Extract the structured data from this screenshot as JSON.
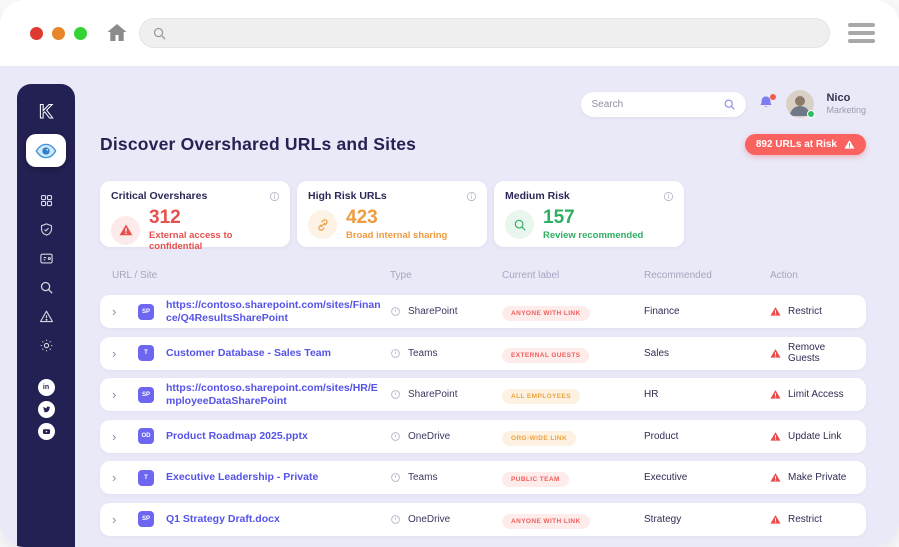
{
  "browser": {
    "traffic_lights": {
      "close": "#df3a32",
      "minimize": "#e8872a",
      "zoom": "#35d435"
    },
    "home_icon": "home-icon",
    "address": {
      "value": "",
      "search_icon": "search-icon"
    },
    "menu_icon": "hamburger-icon"
  },
  "sidebar": {
    "logo": "K",
    "active_item": {
      "icon": "eye"
    },
    "menu": [
      {
        "icon": "grid"
      },
      {
        "icon": "shield-check"
      },
      {
        "icon": "id-card"
      },
      {
        "icon": "search"
      },
      {
        "icon": "warning-outline"
      },
      {
        "icon": "gear"
      }
    ],
    "social": [
      {
        "icon": "linkedin"
      },
      {
        "icon": "twitter"
      },
      {
        "icon": "youtube"
      }
    ]
  },
  "header": {
    "search_placeholder": "Search",
    "notifications_icon": "bell",
    "user": {
      "name": "Nico",
      "role": "Marketing"
    }
  },
  "page": {
    "title": "Discover Overshared URLs and Sites",
    "risk_badge": {
      "label": "892 URLs at Risk",
      "icon": "warning-solid",
      "color": "#f9625f"
    }
  },
  "stats": [
    {
      "title": "Critical Overshares",
      "value": "312",
      "caption": "External access to confidential",
      "icon": "warning-solid",
      "color": "#e8504e",
      "icon_bg": "#fcebea"
    },
    {
      "title": "High Risk URLs",
      "value": "423",
      "caption": "Broad internal sharing",
      "icon": "link",
      "color": "#ef9b3f",
      "icon_bg": "#fdf3e4"
    },
    {
      "title": "Medium Risk",
      "value": "157",
      "caption": "Review recommended",
      "icon": "search",
      "color": "#2fae63",
      "icon_bg": "#e8f6ee"
    }
  ],
  "table": {
    "columns": [
      "URL / Site",
      "Type",
      "Current label",
      "Recommended",
      "Action"
    ],
    "rows": [
      {
        "badge": "SP",
        "name": "https://contoso.sharepoint.com/sites/Finance/Q4ResultsSharePoint",
        "type": "SharePoint",
        "label": "ANYONE WITH LINK",
        "label_tone": "red",
        "recommended": "Finance",
        "action": "Restrict"
      },
      {
        "badge": "T",
        "name": "Customer Database - Sales Team",
        "type": "Teams",
        "label": "EXTERNAL GUESTS",
        "label_tone": "red",
        "recommended": "Sales",
        "action": "Remove Guests"
      },
      {
        "badge": "SP",
        "name": "https://contoso.sharepoint.com/sites/HR/EmployeeDataSharePoint",
        "type": "SharePoint",
        "label": "ALL EMPLOYEES",
        "label_tone": "orange",
        "recommended": "HR",
        "action": "Limit Access"
      },
      {
        "badge": "OD",
        "name": "Product Roadmap 2025.pptx",
        "type": "OneDrive",
        "label": "ORG-WIDE LINK",
        "label_tone": "orange",
        "recommended": "Product",
        "action": "Update Link"
      },
      {
        "badge": "T",
        "name": "Executive Leadership - Private",
        "type": "Teams",
        "label": "PUBLIC TEAM",
        "label_tone": "red",
        "recommended": "Executive",
        "action": "Make Private"
      },
      {
        "badge": "SP",
        "name": "Q1 Strategy Draft.docx",
        "type": "OneDrive",
        "label": "ANYONE WITH LINK",
        "label_tone": "red",
        "recommended": "Strategy",
        "action": "Restrict"
      }
    ]
  }
}
